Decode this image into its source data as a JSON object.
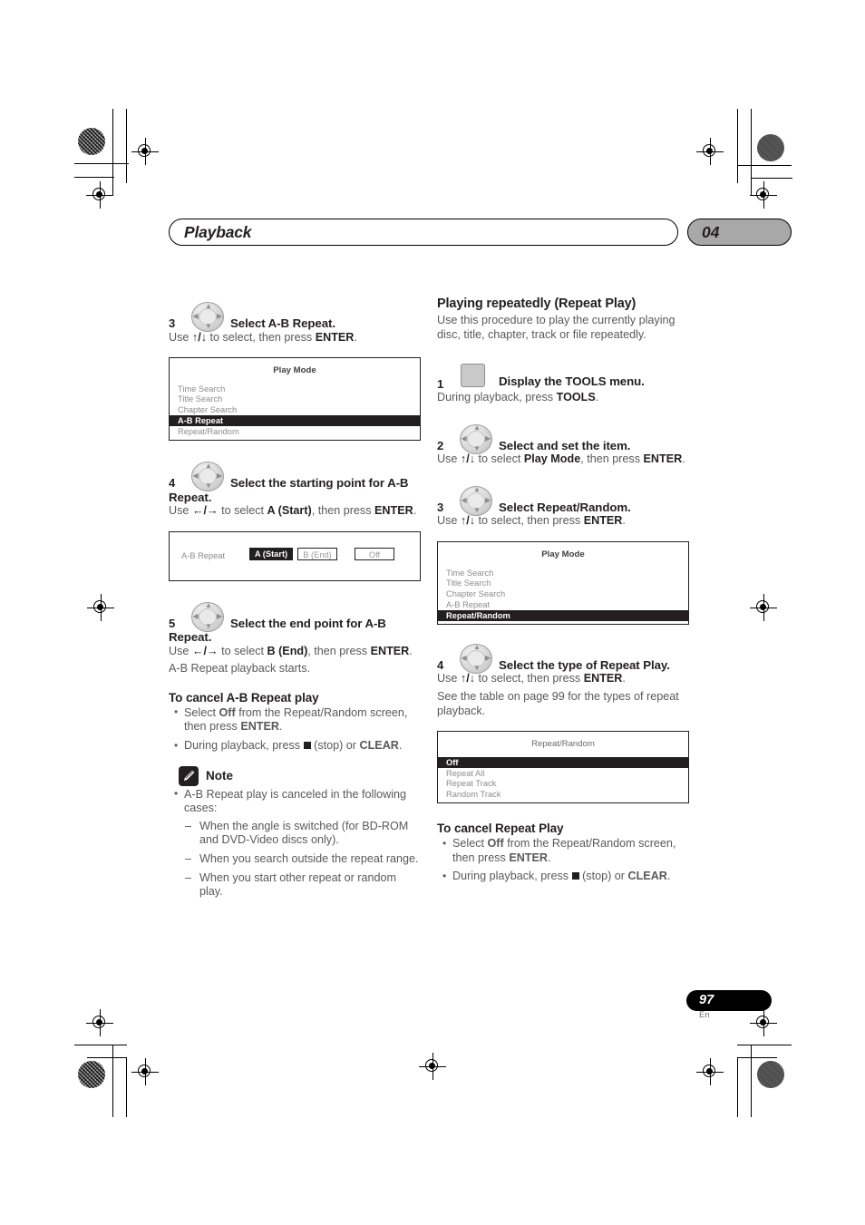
{
  "header": {
    "chapter_title": "Playback",
    "chapter_number": "04"
  },
  "footer": {
    "page_number": "97",
    "language": "En"
  },
  "left_column": {
    "step3": {
      "number": "3",
      "icon": "dpad-icon",
      "title": "Select A-B Repeat.",
      "instruction_pre": "Use ",
      "instruction_arrows": "↑/↓",
      "instruction_mid": " to select, then press ",
      "instruction_key": "ENTER",
      "instruction_end": "."
    },
    "play_mode_osd": {
      "title": "Play Mode",
      "items": [
        {
          "label": "Time Search",
          "selected": false
        },
        {
          "label": "Title Search",
          "selected": false
        },
        {
          "label": "Chapter Search",
          "selected": false
        },
        {
          "label": "A-B Repeat",
          "selected": true
        },
        {
          "label": "Repeat/Random",
          "selected": false
        }
      ]
    },
    "step4": {
      "number": "4",
      "icon": "dpad-icon",
      "title_line1": "Select the starting point for A-B",
      "title_line2": "Repeat.",
      "instruction_pre": "Use ",
      "instruction_arrows": "←/→",
      "instruction_mid": " to select ",
      "instruction_bold": "A (Start)",
      "instruction_mid2": ", then press",
      "instruction_key": "ENTER",
      "instruction_end": "."
    },
    "ab_repeat_osd": {
      "label": "A-B Repeat",
      "options": [
        {
          "label": "A (Start)",
          "state": "selected"
        },
        {
          "label": "B (End)",
          "state": "outlined"
        },
        {
          "label": "Off",
          "state": "outlined"
        }
      ]
    },
    "step5": {
      "number": "5",
      "icon": "dpad-icon",
      "title_line1": "Select the end point for A-B",
      "title_line2": "Repeat.",
      "instruction_pre": "Use ",
      "instruction_arrows": "←/→",
      "instruction_mid": " to select ",
      "instruction_bold": "B (End)",
      "instruction_mid2": ", then press ",
      "instruction_key": "ENTER",
      "instruction_end": ".",
      "note_line": "A-B Repeat playback starts."
    },
    "cancel_section": {
      "heading": "To cancel A-B Repeat play",
      "bullet1_pre": "Select ",
      "bullet1_bold": "Off",
      "bullet1_mid": " from the Repeat/Random screen, then press ",
      "bullet1_key": "ENTER",
      "bullet1_end": ".",
      "bullet2_pre": "During playback, press ",
      "bullet2_stop": " (stop) or ",
      "bullet2_key": "CLEAR",
      "bullet2_end": "."
    },
    "note": {
      "icon": "pencil-note-icon",
      "label": "Note",
      "bullet": "A-B Repeat play is canceled in the following cases:",
      "sub_items": [
        "When the angle is switched (for BD-ROM and DVD-Video discs only).",
        "When you search outside the repeat range.",
        "When you start other repeat or random play."
      ]
    }
  },
  "right_column": {
    "section_heading": "Playing repeatedly (Repeat Play)",
    "intro": "Use this procedure to play the currently playing disc, title, chapter, track or file repeatedly.",
    "step1": {
      "number": "1",
      "icon": "tools-key-icon",
      "title": "Display the TOOLS menu.",
      "instruction_pre": "During playback, press ",
      "instruction_key": "TOOLS",
      "instruction_end": "."
    },
    "step2": {
      "number": "2",
      "icon": "dpad-icon",
      "title": "Select and set the item.",
      "instruction_pre": "Use ",
      "instruction_arrows": "↑/↓",
      "instruction_mid": " to select ",
      "instruction_bold": "Play Mode",
      "instruction_mid2": ", then press",
      "instruction_key": "ENTER",
      "instruction_end": "."
    },
    "step3": {
      "number": "3",
      "icon": "dpad-icon",
      "title": "Select Repeat/Random.",
      "instruction_pre": "Use ",
      "instruction_arrows": "↑/↓",
      "instruction_mid": " to select, then press ",
      "instruction_key": "ENTER",
      "instruction_end": "."
    },
    "play_mode_osd": {
      "title": "Play Mode",
      "items": [
        {
          "label": "Time Search",
          "selected": false
        },
        {
          "label": "Title Search",
          "selected": false
        },
        {
          "label": "Chapter Search",
          "selected": false
        },
        {
          "label": "A-B Repeat",
          "selected": false
        },
        {
          "label": "Repeat/Random",
          "selected": true
        }
      ]
    },
    "step4": {
      "number": "4",
      "icon": "dpad-icon",
      "title": "Select the type of Repeat Play.",
      "instruction_pre": "Use ",
      "instruction_arrows": "↑/↓",
      "instruction_mid": " to select, then press ",
      "instruction_key": "ENTER",
      "instruction_end": ".",
      "reference": "See the table on page 99 for the types of repeat playback."
    },
    "repeat_random_osd": {
      "title": "Repeat/Random",
      "items": [
        {
          "label": "Off",
          "selected": true
        },
        {
          "label": "Repeat All",
          "selected": false
        },
        {
          "label": "Repeat Track",
          "selected": false
        },
        {
          "label": "Random Track",
          "selected": false
        }
      ]
    },
    "cancel_section": {
      "heading": "To cancel Repeat Play",
      "bullet1_pre": "Select ",
      "bullet1_bold": "Off",
      "bullet1_mid": " from the Repeat/Random screen, then press ",
      "bullet1_key": "ENTER",
      "bullet1_end": ".",
      "bullet2_pre": "During playback, press ",
      "bullet2_stop": " (stop) or ",
      "bullet2_key": "CLEAR",
      "bullet2_end": "."
    }
  }
}
